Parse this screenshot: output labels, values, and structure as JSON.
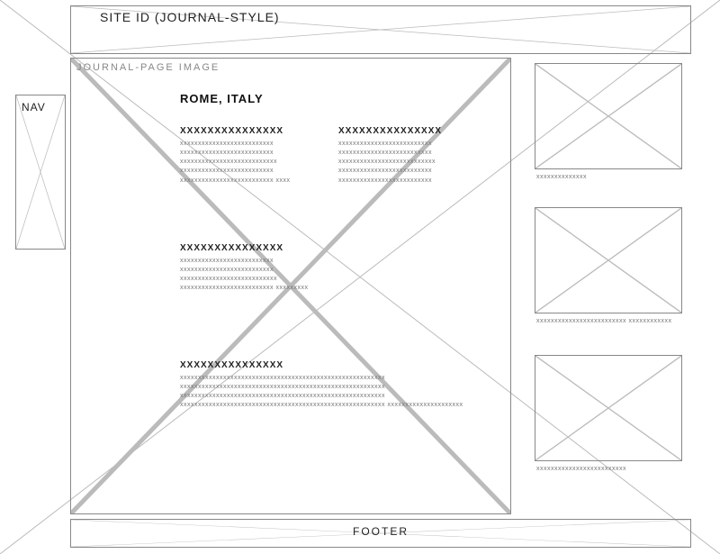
{
  "header": {
    "site_id": "SITE ID (JOURNAL-STYLE)"
  },
  "nav": {
    "label": "NAV"
  },
  "journal": {
    "image_label": "JOURNAL-PAGE IMAGE",
    "page_title": "ROME, ITALY",
    "sections": {
      "s1": {
        "heading": "XXXXXXXXXXXXXXX",
        "body": "xxxxxxxxxxxxxxxxxxxxxxxxxx xxxxxxxxxxxxxxxxxxxxxxxxxx xxxxxxxxxxxxxxxxxxxxxxxxxxx xxxxxxxxxxxxxxxxxxxxxxxxxx xxxxxxxxxxxxxxxxxxxxxxxxxx xxxx"
      },
      "s2": {
        "heading": "XXXXXXXXXXXXXXX",
        "body": "xxxxxxxxxxxxxxxxxxxxxxxxxx xxxxxxxxxxxxxxxxxxxxxxxxxx xxxxxxxxxxxxxxxxxxxxxxxxxxx xxxxxxxxxxxxxxxxxxxxxxxxxx xxxxxxxxxxxxxxxxxxxxxxxxxx"
      },
      "s3": {
        "heading": "XXXXXXXXXXXXXXX",
        "body": "xxxxxxxxxxxxxxxxxxxxxxxxxx xxxxxxxxxxxxxxxxxxxxxxxxxx xxxxxxxxxxxxxxxxxxxxxxxxxxx xxxxxxxxxxxxxxxxxxxxxxxxxx xxxxxxxxx"
      },
      "s4": {
        "heading": "XXXXXXXXXXXXXXX",
        "body": "xxxxxxxxxxxxxxxxxxxxxxxxxxxxxxxxxxxxxxxxxxxxxxxxxxxxxxxxx xxxxxxxxxxxxxxxxxxxxxxxxxxxxxxxxxxxxxxxxxxxxxxxxxxxxxxxxx xxxxxxxxxxxxxxxxxxxxxxxxxxxxxxxxxxxxxxxxxxxxxxxxxxxxxxxxx xxxxxxxxxxxxxxxxxxxxxxxxxxxxxxxxxxxxxxxxxxxxxxxxxxxxxxxxx xxxxxxxxxxxxxxxxxxxxx"
      }
    }
  },
  "sidebar": {
    "thumbs": [
      {
        "caption": "xxxxxxxxxxxxxx"
      },
      {
        "caption": "xxxxxxxxxxxxxxxxxxxxxxxxx\nxxxxxxxxxxxx"
      },
      {
        "caption": "xxxxxxxxxxxxxxxxxxxxxxxxx"
      }
    ]
  },
  "footer": {
    "label": "FOOTER"
  }
}
